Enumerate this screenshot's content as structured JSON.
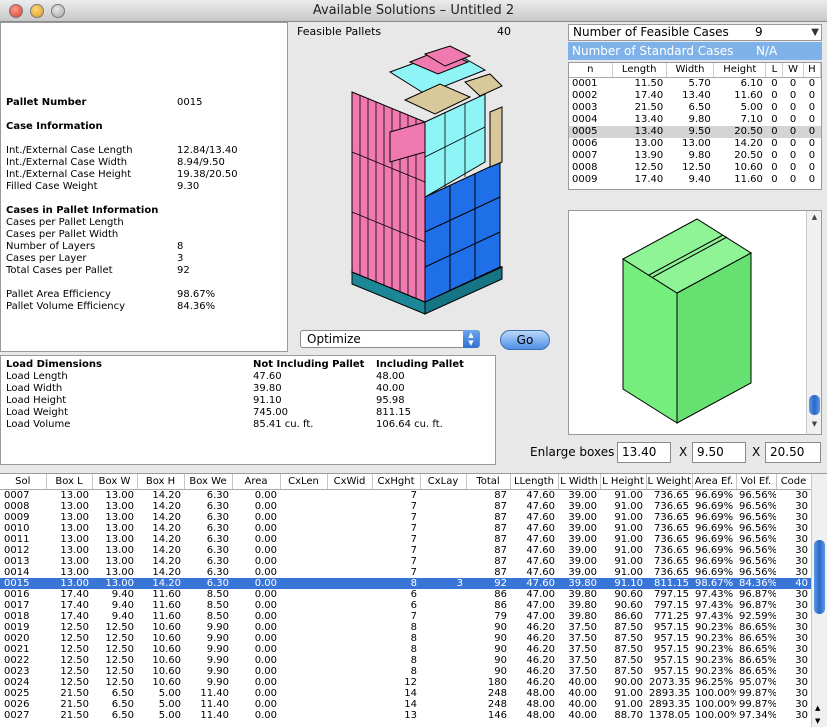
{
  "window": {
    "title": "Available Solutions – Untitled 2"
  },
  "info": {
    "pallet_number_label": "Pallet Number",
    "pallet_number": "0015",
    "case_info_head": "Case Information",
    "rows1": [
      {
        "label": "Int./External Case Length",
        "value": "12.84/13.40"
      },
      {
        "label": "Int./External Case Width",
        "value": "8.94/9.50"
      },
      {
        "label": "Int./External Case Height",
        "value": "19.38/20.50"
      },
      {
        "label": "Filled Case Weight",
        "value": "9.30"
      }
    ],
    "pallet_info_head": "Cases in Pallet Information",
    "rows2": [
      {
        "label": "Cases per Pallet Length",
        "value": ""
      },
      {
        "label": "Cases per Pallet Width",
        "value": ""
      },
      {
        "label": "Number of Layers",
        "value": "8"
      },
      {
        "label": "Cases per Layer",
        "value": "3"
      },
      {
        "label": "Total Cases per Pallet",
        "value": "92"
      }
    ],
    "rows3": [
      {
        "label": "Pallet Area Efficiency",
        "value": "98.67%"
      },
      {
        "label": "Pallet Volume Efficiency",
        "value": "84.36%"
      }
    ]
  },
  "feasible_pallets": {
    "label": "Feasible Pallets",
    "value": "40"
  },
  "optimize": {
    "selected": "Optimize",
    "go_label": "Go"
  },
  "num_feasible": {
    "label": "Number of Feasible Cases",
    "value": "9"
  },
  "num_standard": {
    "label": "Number of Standard Cases",
    "value": "N/A"
  },
  "case_table": {
    "headers": [
      "n",
      "Length",
      "Width",
      "Height",
      "L",
      "W",
      "H"
    ],
    "rows": [
      [
        "0001",
        "11.50",
        "5.70",
        "6.10",
        "0",
        "0",
        "0"
      ],
      [
        "0002",
        "17.40",
        "13.40",
        "11.60",
        "0",
        "0",
        "0"
      ],
      [
        "0003",
        "21.50",
        "6.50",
        "5.00",
        "0",
        "0",
        "0"
      ],
      [
        "0004",
        "13.40",
        "9.80",
        "7.10",
        "0",
        "0",
        "0"
      ],
      [
        "0005",
        "13.40",
        "9.50",
        "20.50",
        "0",
        "0",
        "0"
      ],
      [
        "0006",
        "13.00",
        "13.00",
        "14.20",
        "0",
        "0",
        "0"
      ],
      [
        "0007",
        "13.90",
        "9.80",
        "20.50",
        "0",
        "0",
        "0"
      ],
      [
        "0008",
        "12.50",
        "12.50",
        "10.60",
        "0",
        "0",
        "0"
      ],
      [
        "0009",
        "17.40",
        "9.40",
        "11.60",
        "0",
        "0",
        "0"
      ]
    ],
    "selected_index": 4
  },
  "enlarge": {
    "label": "Enlarge boxes",
    "x_sep": "X",
    "length": "13.40",
    "width": "9.50",
    "height": "20.50"
  },
  "load": {
    "head": [
      "Load Dimensions",
      "Not Including Pallet",
      "Including Pallet"
    ],
    "rows": [
      [
        "Load Length",
        "47.60",
        "48.00"
      ],
      [
        "Load Width",
        "39.80",
        "40.00"
      ],
      [
        "Load Height",
        "91.10",
        "95.98"
      ],
      [
        "Load Weight",
        "745.00",
        "811.15"
      ],
      [
        "Load Volume",
        "85.41 cu. ft.",
        "106.64 cu. ft."
      ]
    ]
  },
  "solutions": {
    "headers": [
      "Sol",
      "Box L",
      "Box W",
      "Box H",
      "Box We",
      "Area",
      "CxLen",
      "CxWid",
      "CxHght",
      "CxLay",
      "Total",
      "LLength",
      "L Width",
      "L Height",
      "L Weight",
      "Area Ef.",
      "Vol Ef.",
      "Code"
    ],
    "rows": [
      [
        "0007",
        "13.00",
        "13.00",
        "14.20",
        "6.30",
        "0.00",
        "",
        "",
        "7",
        "",
        "87",
        "47.60",
        "39.00",
        "91.00",
        "736.65",
        "96.69%",
        "96.56%",
        "30"
      ],
      [
        "0008",
        "13.00",
        "13.00",
        "14.20",
        "6.30",
        "0.00",
        "",
        "",
        "7",
        "",
        "87",
        "47.60",
        "39.00",
        "91.00",
        "736.65",
        "96.69%",
        "96.56%",
        "30"
      ],
      [
        "0009",
        "13.00",
        "13.00",
        "14.20",
        "6.30",
        "0.00",
        "",
        "",
        "7",
        "",
        "87",
        "47.60",
        "39.00",
        "91.00",
        "736.65",
        "96.69%",
        "96.56%",
        "30"
      ],
      [
        "0010",
        "13.00",
        "13.00",
        "14.20",
        "6.30",
        "0.00",
        "",
        "",
        "7",
        "",
        "87",
        "47.60",
        "39.00",
        "91.00",
        "736.65",
        "96.69%",
        "96.56%",
        "30"
      ],
      [
        "0011",
        "13.00",
        "13.00",
        "14.20",
        "6.30",
        "0.00",
        "",
        "",
        "7",
        "",
        "87",
        "47.60",
        "39.00",
        "91.00",
        "736.65",
        "96.69%",
        "96.56%",
        "30"
      ],
      [
        "0012",
        "13.00",
        "13.00",
        "14.20",
        "6.30",
        "0.00",
        "",
        "",
        "7",
        "",
        "87",
        "47.60",
        "39.00",
        "91.00",
        "736.65",
        "96.69%",
        "96.56%",
        "30"
      ],
      [
        "0013",
        "13.00",
        "13.00",
        "14.20",
        "6.30",
        "0.00",
        "",
        "",
        "7",
        "",
        "87",
        "47.60",
        "39.00",
        "91.00",
        "736.65",
        "96.69%",
        "96.56%",
        "30"
      ],
      [
        "0014",
        "13.00",
        "13.00",
        "14.20",
        "6.30",
        "0.00",
        "",
        "",
        "7",
        "",
        "87",
        "47.60",
        "39.00",
        "91.00",
        "736.65",
        "96.69%",
        "96.56%",
        "30"
      ],
      [
        "0015",
        "13.00",
        "13.00",
        "14.20",
        "6.30",
        "0.00",
        "",
        "",
        "8",
        "3",
        "92",
        "47.60",
        "39.80",
        "91.10",
        "811.15",
        "98.67%",
        "84.36%",
        "40"
      ],
      [
        "0016",
        "17.40",
        "9.40",
        "11.60",
        "8.50",
        "0.00",
        "",
        "",
        "6",
        "",
        "86",
        "47.00",
        "39.80",
        "90.60",
        "797.15",
        "97.43%",
        "96.87%",
        "30"
      ],
      [
        "0017",
        "17.40",
        "9.40",
        "11.60",
        "8.50",
        "0.00",
        "",
        "",
        "6",
        "",
        "86",
        "47.00",
        "39.80",
        "90.60",
        "797.15",
        "97.43%",
        "96.87%",
        "30"
      ],
      [
        "0018",
        "17.40",
        "9.40",
        "11.60",
        "8.50",
        "0.00",
        "",
        "",
        "7",
        "",
        "79",
        "47.00",
        "39.80",
        "86.60",
        "771.25",
        "97.43%",
        "92.59%",
        "30"
      ],
      [
        "0019",
        "12.50",
        "12.50",
        "10.60",
        "9.90",
        "0.00",
        "",
        "",
        "8",
        "",
        "90",
        "46.20",
        "37.50",
        "87.50",
        "957.15",
        "90.23%",
        "86.65%",
        "30"
      ],
      [
        "0020",
        "12.50",
        "12.50",
        "10.60",
        "9.90",
        "0.00",
        "",
        "",
        "8",
        "",
        "90",
        "46.20",
        "37.50",
        "87.50",
        "957.15",
        "90.23%",
        "86.65%",
        "30"
      ],
      [
        "0021",
        "12.50",
        "12.50",
        "10.60",
        "9.90",
        "0.00",
        "",
        "",
        "8",
        "",
        "90",
        "46.20",
        "37.50",
        "87.50",
        "957.15",
        "90.23%",
        "86.65%",
        "30"
      ],
      [
        "0022",
        "12.50",
        "12.50",
        "10.60",
        "9.90",
        "0.00",
        "",
        "",
        "8",
        "",
        "90",
        "46.20",
        "37.50",
        "87.50",
        "957.15",
        "90.23%",
        "86.65%",
        "30"
      ],
      [
        "0023",
        "12.50",
        "12.50",
        "10.60",
        "9.90",
        "0.00",
        "",
        "",
        "8",
        "",
        "90",
        "46.20",
        "37.50",
        "87.50",
        "957.15",
        "90.23%",
        "86.65%",
        "30"
      ],
      [
        "0024",
        "12.50",
        "12.50",
        "10.60",
        "9.90",
        "0.00",
        "",
        "",
        "12",
        "",
        "180",
        "46.20",
        "40.00",
        "90.00",
        "2073.35",
        "96.25%",
        "95.07%",
        "30"
      ],
      [
        "0025",
        "21.50",
        "6.50",
        "5.00",
        "11.40",
        "0.00",
        "",
        "",
        "14",
        "",
        "248",
        "48.00",
        "40.00",
        "91.00",
        "2893.35",
        "100.00%",
        "99.87%",
        "30"
      ],
      [
        "0026",
        "21.50",
        "6.50",
        "5.00",
        "11.40",
        "0.00",
        "",
        "",
        "14",
        "",
        "248",
        "48.00",
        "40.00",
        "91.00",
        "2893.35",
        "100.00%",
        "99.87%",
        "30"
      ],
      [
        "0027",
        "21.50",
        "6.50",
        "5.00",
        "11.40",
        "0.00",
        "",
        "",
        "13",
        "",
        "146",
        "48.00",
        "40.00",
        "88.70",
        "1378.05",
        "100.00%",
        "97.34%",
        "30"
      ]
    ],
    "selected_index": 8
  }
}
